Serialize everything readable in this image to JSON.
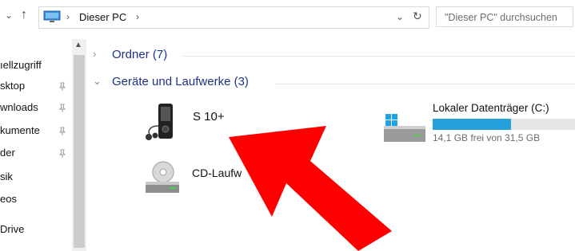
{
  "address": {
    "crumb": "Dieser PC",
    "search_placeholder": "\"Dieser PC\" durchsuchen"
  },
  "sidebar": {
    "items": [
      {
        "label": "ıellzugriff",
        "pinned": false
      },
      {
        "label": "sktop",
        "pinned": true
      },
      {
        "label": "wnloads",
        "pinned": true
      },
      {
        "label": "kumente",
        "pinned": true
      },
      {
        "label": "der",
        "pinned": true
      },
      {
        "label": "sik",
        "pinned": false
      },
      {
        "label": "eos",
        "pinned": false
      },
      {
        "label": "Drive",
        "pinned": false
      }
    ]
  },
  "groups": {
    "folders": {
      "label": "Ordner (7)",
      "collapsed": true
    },
    "devices": {
      "label": "Geräte und Laufwerke (3)",
      "collapsed": false
    }
  },
  "devices": {
    "phone": {
      "label": "S 10+",
      "icon": "media-player-icon"
    },
    "cdrom": {
      "label": "CD-Laufw",
      "icon": "cd-drive-icon"
    },
    "disk": {
      "label": "Lokaler Datenträger (C:)",
      "free": "14,1 GB frei von 31,5 GB",
      "used_fraction": 0.55,
      "icon": "windows-drive-icon"
    }
  },
  "annotation": {
    "color": "#ff0000",
    "icon": "red-arrow"
  },
  "colors": {
    "group_header": "#1e3287",
    "progress": "#26a0da"
  }
}
